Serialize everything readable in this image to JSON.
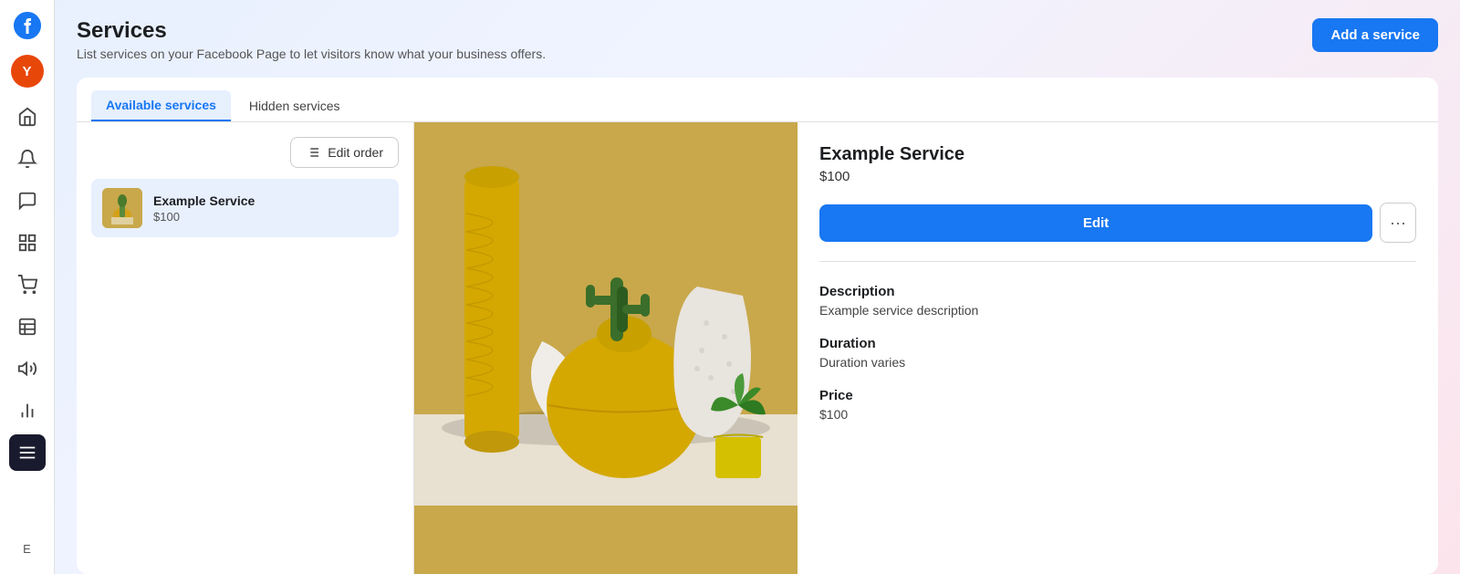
{
  "app": {
    "logo_initial": "f",
    "user_initial": "Y",
    "user_bg": "#e8470a"
  },
  "sidebar": {
    "items": [
      {
        "name": "home",
        "icon": "home",
        "active": false
      },
      {
        "name": "notifications",
        "icon": "bell",
        "active": false
      },
      {
        "name": "messages",
        "icon": "chat",
        "active": false
      },
      {
        "name": "pages",
        "icon": "pages",
        "active": false
      },
      {
        "name": "shop",
        "icon": "shop",
        "active": false
      },
      {
        "name": "table",
        "icon": "table",
        "active": false
      },
      {
        "name": "megaphone",
        "icon": "megaphone",
        "active": false
      },
      {
        "name": "analytics",
        "icon": "analytics",
        "active": false
      },
      {
        "name": "menu",
        "icon": "menu",
        "active": true
      }
    ],
    "bottom_label": "E"
  },
  "header": {
    "title": "Services",
    "subtitle": "List services on your Facebook Page to let visitors know what your business offers.",
    "add_button_label": "Add a service"
  },
  "tabs": [
    {
      "id": "available",
      "label": "Available services",
      "active": true
    },
    {
      "id": "hidden",
      "label": "Hidden services",
      "active": false
    }
  ],
  "left_panel": {
    "edit_order_label": "Edit order",
    "service_item": {
      "name": "Example Service",
      "price": "$100"
    }
  },
  "right_panel": {
    "service": {
      "name": "Example Service",
      "price": "$100",
      "edit_label": "Edit",
      "more_label": "···",
      "description_label": "Description",
      "description_value": "Example service description",
      "duration_label": "Duration",
      "duration_value": "Duration varies",
      "price_label": "Price",
      "price_value": "$100"
    }
  }
}
